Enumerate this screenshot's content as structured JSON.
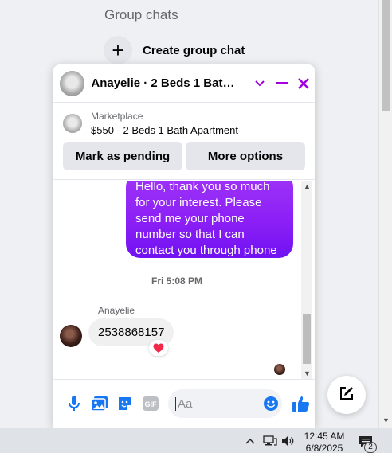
{
  "background": {
    "heading": "Group chats",
    "create_label": "Create group chat"
  },
  "chat": {
    "title": "Anayelie · 2 Beds 1 Bath A...",
    "listing": {
      "label": "Marketplace",
      "title": "$550 - 2 Beds 1 Bath Apartment",
      "pending_button": "Mark as pending",
      "more_button": "More options"
    },
    "messages": {
      "outgoing_text": "Hello, thank you so much for your interest. Please send me your phone number so that I can contact you through phone",
      "time_separator": "Fri 5:08 PM",
      "sender_name": "Anayelie",
      "incoming_text": "2538868157",
      "reaction": "❤️"
    },
    "composer": {
      "placeholder": "Aa"
    }
  },
  "taskbar": {
    "time": "12:45 AM",
    "date": "6/8/2025",
    "notification_count": "2"
  },
  "colors": {
    "accent_purple": "#a000e0",
    "messenger_blue": "#1877f2",
    "bubble_gradient_top": "#a034f8",
    "bubble_gradient_bottom": "#7012f2"
  },
  "icons": [
    "plus-icon",
    "chevron-down-icon",
    "minimize-icon",
    "close-icon",
    "microphone-icon",
    "photo-icon",
    "sticker-icon",
    "gif-icon",
    "emoji-icon",
    "thumbs-up-icon",
    "compose-icon",
    "chevron-up-icon",
    "network-icon",
    "volume-icon",
    "notification-icon"
  ]
}
